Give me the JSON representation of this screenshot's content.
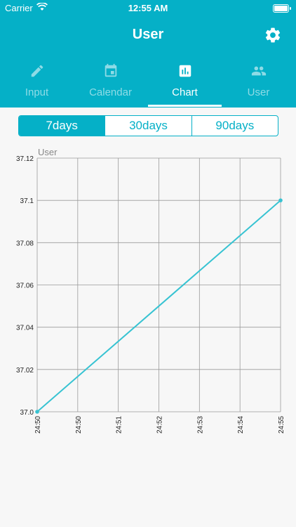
{
  "status_bar": {
    "carrier": "Carrier",
    "time": "12:55 AM"
  },
  "header": {
    "title": "User"
  },
  "tabs": [
    {
      "label": "Input",
      "icon": "pencil-icon",
      "active": false
    },
    {
      "label": "Calendar",
      "icon": "calendar-icon",
      "active": false
    },
    {
      "label": "Chart",
      "icon": "bar-chart-icon",
      "active": true
    },
    {
      "label": "User",
      "icon": "users-icon",
      "active": false
    }
  ],
  "range_selector": {
    "options": [
      "7days",
      "30days",
      "90days"
    ],
    "selected": "7days"
  },
  "colors": {
    "accent": "#05b0c7",
    "line": "#37c3d2",
    "grid": "#9a9a9a"
  },
  "chart_data": {
    "type": "line",
    "series": [
      {
        "name": "User",
        "x": [
          "24:50",
          "24:55"
        ],
        "y": [
          37.0,
          37.1
        ]
      }
    ],
    "x_ticks": [
      "24:50",
      "24:50",
      "24:51",
      "24:52",
      "24:53",
      "24:54",
      "24:55"
    ],
    "y_ticks": [
      "37.0",
      "37.02",
      "37.04",
      "37.06",
      "37.08",
      "37.1",
      "37.12"
    ],
    "ylim": [
      37.0,
      37.12
    ],
    "grid": true,
    "legend_label": "User"
  }
}
